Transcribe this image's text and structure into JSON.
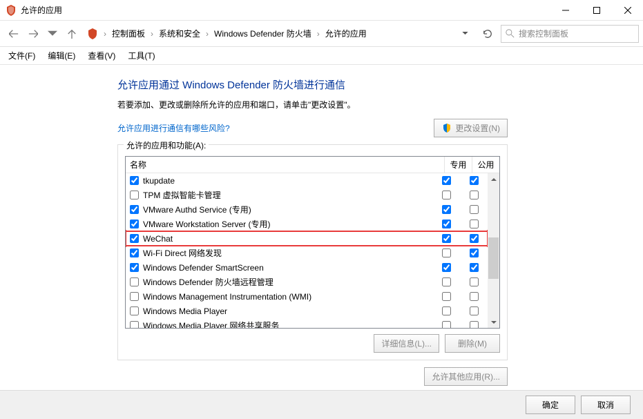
{
  "window": {
    "title": "允许的应用"
  },
  "nav": {
    "breadcrumb": [
      "控制面板",
      "系统和安全",
      "Windows Defender 防火墙",
      "允许的应用"
    ],
    "search_placeholder": "搜索控制面板"
  },
  "menu": {
    "file": "文件(F)",
    "edit": "编辑(E)",
    "view": "查看(V)",
    "tools": "工具(T)"
  },
  "page": {
    "title": "允许应用通过 Windows Defender 防火墙进行通信",
    "desc": "若要添加、更改或删除所允许的应用和端口，请单击\"更改设置\"。",
    "risk_link": "允许应用进行通信有哪些风险?",
    "change_settings": "更改设置(N)"
  },
  "list": {
    "title": "允许的应用和功能(A):",
    "col_name": "名称",
    "col_private": "专用",
    "col_public": "公用",
    "rows": [
      {
        "name": "tkupdate",
        "enabled": true,
        "private": true,
        "public": true,
        "highlight": false
      },
      {
        "name": "TPM 虚拟智能卡管理",
        "enabled": false,
        "private": false,
        "public": false,
        "highlight": false
      },
      {
        "name": "VMware Authd Service (专用)",
        "enabled": true,
        "private": true,
        "public": false,
        "highlight": false
      },
      {
        "name": "VMware Workstation Server (专用)",
        "enabled": true,
        "private": true,
        "public": false,
        "highlight": false
      },
      {
        "name": "WeChat",
        "enabled": true,
        "private": true,
        "public": true,
        "highlight": true
      },
      {
        "name": "Wi-Fi Direct 网络发现",
        "enabled": true,
        "private": false,
        "public": true,
        "highlight": false
      },
      {
        "name": "Windows Defender SmartScreen",
        "enabled": true,
        "private": true,
        "public": true,
        "highlight": false
      },
      {
        "name": "Windows Defender 防火墙远程管理",
        "enabled": false,
        "private": false,
        "public": false,
        "highlight": false
      },
      {
        "name": "Windows Management Instrumentation (WMI)",
        "enabled": false,
        "private": false,
        "public": false,
        "highlight": false
      },
      {
        "name": "Windows Media Player",
        "enabled": false,
        "private": false,
        "public": false,
        "highlight": false
      },
      {
        "name": "Windows Media Player 网络共享服务",
        "enabled": false,
        "private": false,
        "public": false,
        "highlight": false
      }
    ],
    "details_btn": "详细信息(L)...",
    "delete_btn": "删除(M)",
    "other_app_btn": "允许其他应用(R)..."
  },
  "bottom": {
    "ok": "确定",
    "cancel": "取消"
  }
}
